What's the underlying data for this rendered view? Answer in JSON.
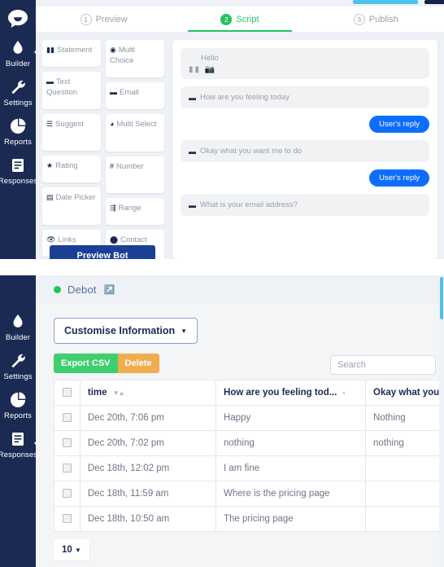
{
  "sidebar": {
    "logo_icon": "chat-bubble-logo",
    "items": [
      {
        "label": "Builder",
        "icon": "droplet-icon",
        "active": true
      },
      {
        "label": "Settings",
        "icon": "wrench-icon",
        "active": false
      },
      {
        "label": "Reports",
        "icon": "pie-chart-icon",
        "active": false
      },
      {
        "label": "Responses",
        "icon": "document-icon",
        "active": false
      }
    ]
  },
  "builder": {
    "tabs": [
      {
        "num": "1",
        "label": "Preview",
        "active": false
      },
      {
        "num": "2",
        "label": "Script",
        "active": true
      },
      {
        "num": "3",
        "label": "Publish",
        "active": false
      }
    ],
    "palette_left": [
      {
        "label": "Statement",
        "icon": "statement-icon"
      },
      {
        "label": "Text Question",
        "icon": "text-question-icon"
      },
      {
        "label": "Suggest",
        "icon": "suggest-icon"
      },
      {
        "label": "Rating",
        "icon": "star-icon"
      },
      {
        "label": "Date Picker",
        "icon": "calendar-icon"
      },
      {
        "label": "Links",
        "icon": "link-icon"
      }
    ],
    "palette_right": [
      {
        "label": "Multi Choice",
        "icon": "radio-icon"
      },
      {
        "label": "Email",
        "icon": "email-icon"
      },
      {
        "label": "Multi Select",
        "icon": "check-circle-icon"
      },
      {
        "label": "Number",
        "icon": "hash-icon"
      },
      {
        "label": "Range",
        "icon": "range-icon"
      },
      {
        "label": "Contact",
        "icon": "contact-icon"
      }
    ],
    "preview_bot_label": "Preview Bot",
    "script": {
      "greeting": {
        "text": "Hello",
        "icons": "statement-icon image-icon"
      },
      "messages": [
        {
          "type": "bot",
          "icon": "text-question-icon",
          "text": "How are you feeling today"
        },
        {
          "type": "user",
          "text": "User's reply"
        },
        {
          "type": "bot",
          "icon": "text-question-icon",
          "text": "Okay what you want me to do"
        },
        {
          "type": "user",
          "text": "User's reply"
        },
        {
          "type": "bot",
          "icon": "email-icon",
          "text": "What is your email address?"
        }
      ]
    }
  },
  "responses": {
    "bot_name": "Debot",
    "status_icon": "online-dot",
    "external_link_icon": "external-link-icon",
    "customise_label": "Customise Information",
    "caret_icon": "caret-down-icon",
    "export_csv_label": "Export CSV",
    "delete_label": "Delete",
    "search_placeholder": "Search",
    "columns": [
      {
        "key": "cb",
        "label": ""
      },
      {
        "key": "time",
        "label": "time",
        "sortable": true
      },
      {
        "key": "q1",
        "label": "How are you feeling tod...",
        "sortable": true
      },
      {
        "key": "q2",
        "label": "Okay what you wa"
      }
    ],
    "rows": [
      {
        "time": "Dec 20th, 7:06 pm",
        "q1": "Happy",
        "q2": "Nothing"
      },
      {
        "time": "Dec 20th, 7:02 pm",
        "q1": "nothing",
        "q2": "nothing"
      },
      {
        "time": "Dec 18th, 12:02 pm",
        "q1": "I am fine",
        "q2": ""
      },
      {
        "time": "Dec 18th, 11:59 am",
        "q1": "Where is the pricing page",
        "q2": ""
      },
      {
        "time": "Dec 18th, 10:50 am",
        "q1": "The pricing page",
        "q2": ""
      }
    ],
    "page_size": "10"
  },
  "colors": {
    "sidebar": "#1b2a52",
    "active_tab": "#22c55e",
    "user_reply": "#0d6efd",
    "export_csv": "#3ecf6e",
    "delete": "#f0ad4e",
    "online": "#23c552",
    "scrollbar": "#4dc3ea",
    "preview_button": "#1a3f96"
  }
}
